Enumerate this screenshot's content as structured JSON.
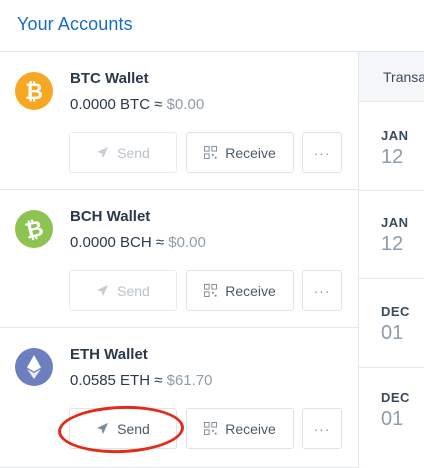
{
  "header": {
    "title": "Your Accounts"
  },
  "accounts": [
    {
      "name": "BTC Wallet",
      "balance": "0.0000 BTC",
      "approx": "≈",
      "fiat": "$0.00",
      "coin_color": "#f7a724",
      "coin_icon": "bitcoin-icon",
      "send_label": "Send",
      "receive_label": "Receive",
      "more_label": "···",
      "send_enabled": false
    },
    {
      "name": "BCH Wallet",
      "balance": "0.0000 BCH",
      "approx": "≈",
      "fiat": "$0.00",
      "coin_color": "#8dc351",
      "coin_icon": "bitcoin-cash-icon",
      "send_label": "Send",
      "receive_label": "Receive",
      "more_label": "···",
      "send_enabled": false
    },
    {
      "name": "ETH Wallet",
      "balance": "0.0585 ETH",
      "approx": "≈",
      "fiat": "$61.70",
      "coin_color": "#6d7fbf",
      "coin_icon": "ethereum-icon",
      "send_label": "Send",
      "receive_label": "Receive",
      "more_label": "···",
      "send_enabled": true
    }
  ],
  "transactions": {
    "header_label": "Transa",
    "dates": [
      {
        "month": "JAN",
        "day": "12"
      },
      {
        "month": "JAN",
        "day": "12"
      },
      {
        "month": "DEC",
        "day": "01"
      },
      {
        "month": "DEC",
        "day": "01"
      }
    ]
  },
  "colors": {
    "accent": "#1a6cc7",
    "highlight": "#e32b1b"
  }
}
